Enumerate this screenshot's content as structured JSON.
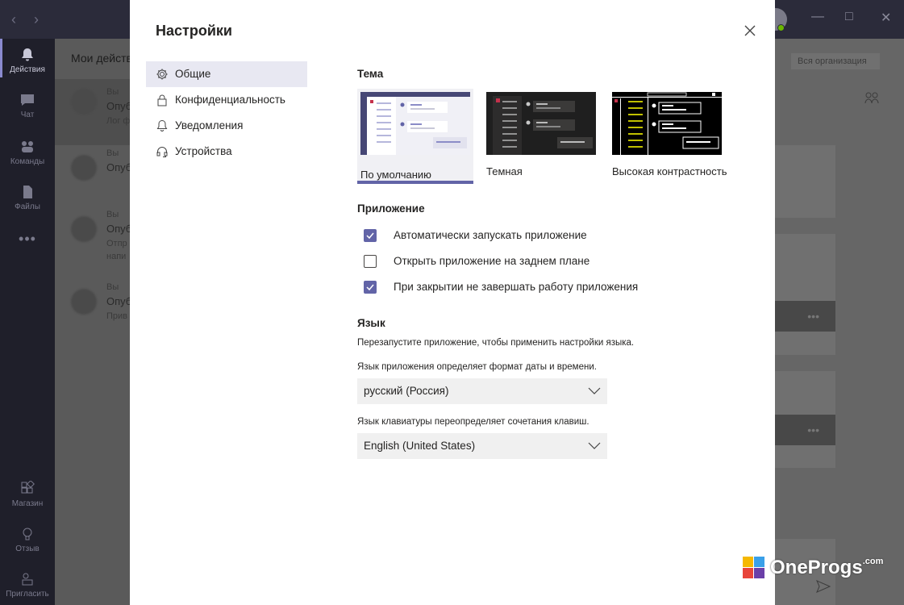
{
  "background": {
    "rail": [
      {
        "label": "Действия",
        "icon": "bell-icon"
      },
      {
        "label": "Чат",
        "icon": "chat-icon"
      },
      {
        "label": "Команды",
        "icon": "teams-icon"
      },
      {
        "label": "Файлы",
        "icon": "file-icon"
      },
      {
        "label": "Магазин",
        "icon": "store-icon"
      },
      {
        "label": "Отзыв",
        "icon": "bulb-icon"
      },
      {
        "label": "Пригласить",
        "icon": "invite-icon"
      }
    ],
    "feed_title": "Мои действия",
    "feed_items": [
      {
        "line1": "Вы",
        "line2": "Опуб",
        "line3": "Лог ф"
      },
      {
        "line1": "Вы",
        "line2": "Опуб",
        "line3": ""
      },
      {
        "line1": "Вы",
        "line2": "Опуб",
        "line3": "Отпр",
        "line4": "напи"
      },
      {
        "line1": "Вы",
        "line2": "Опуб",
        "line3": "Прив"
      }
    ],
    "org_chip": "Вся организация"
  },
  "dialog": {
    "title": "Настройки",
    "nav": [
      {
        "label": "Общие",
        "icon": "gear-icon"
      },
      {
        "label": "Конфиденциальность",
        "icon": "lock-icon"
      },
      {
        "label": "Уведомления",
        "icon": "bell-icon"
      },
      {
        "label": "Устройства",
        "icon": "headset-icon"
      }
    ],
    "theme": {
      "heading": "Тема",
      "options": [
        {
          "label": "По умолчанию",
          "selected": true
        },
        {
          "label": "Темная",
          "selected": false
        },
        {
          "label": "Высокая контрастность",
          "selected": false
        }
      ]
    },
    "app": {
      "heading": "Приложение",
      "options": [
        {
          "label": "Автоматически запускать приложение",
          "checked": true
        },
        {
          "label": "Открыть приложение на заднем плане",
          "checked": false
        },
        {
          "label": "При закрытии не завершать работу приложения",
          "checked": true
        }
      ]
    },
    "language": {
      "heading": "Язык",
      "restart_note": "Перезапустите приложение, чтобы применить настройки языка.",
      "app_lang_note": "Язык приложения определяет формат даты и времени.",
      "app_lang_value": "русский (Россия)",
      "kbd_lang_note": "Язык клавиатуры переопределяет сочетания клавиш.",
      "kbd_lang_value": "English (United States)"
    }
  },
  "watermark": {
    "text": "OneProgs",
    "suffix": ".com"
  },
  "colors": {
    "accent": "#6264a7",
    "dialog_bg": "#ffffff",
    "rail_bg": "#1f1f2a"
  }
}
